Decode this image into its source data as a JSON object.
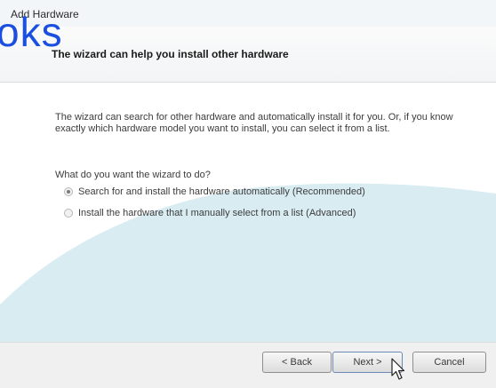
{
  "window": {
    "title": "Add Hardware"
  },
  "watermark": {
    "text": "oks"
  },
  "header": {
    "title": "The wizard can help you install other hardware"
  },
  "body": {
    "paragraph": "The wizard can search for other hardware and automatically install it for you. Or, if you know exactly which hardware model you want to install, you can select it from a list.",
    "question": "What do you want the wizard to do?",
    "options": [
      {
        "label": "Search for and install the hardware automatically (Recommended)",
        "selected": true
      },
      {
        "label": "Install the hardware that I manually select from a list (Advanced)",
        "selected": false
      }
    ]
  },
  "buttons": {
    "back": "< Back",
    "next": "Next >",
    "cancel": "Cancel"
  },
  "colors": {
    "accent_swoosh": "#d8ecf2",
    "watermark": "#1a4fe0"
  }
}
